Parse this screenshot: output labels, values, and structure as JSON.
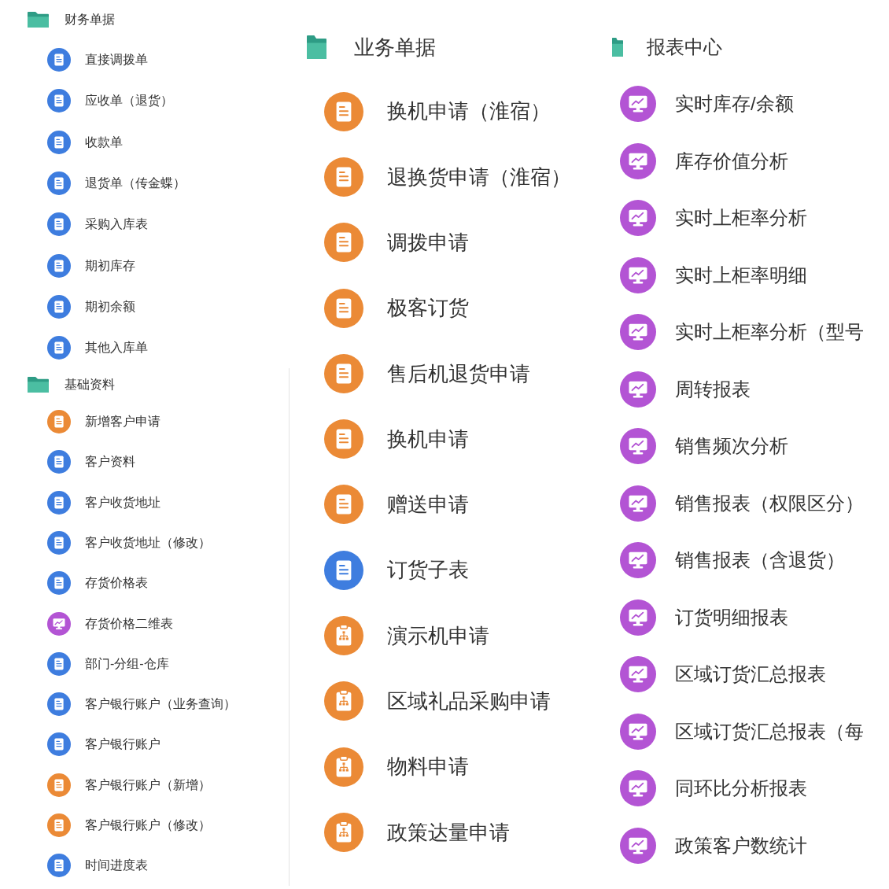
{
  "columns": [
    {
      "sections": [
        {
          "title": "财务单据",
          "items": [
            {
              "label": "直接调拨单",
              "kind": "document",
              "color": "#3e7ddf"
            },
            {
              "label": "应收单（退货）",
              "kind": "document",
              "color": "#3e7ddf"
            },
            {
              "label": "收款单",
              "kind": "document",
              "color": "#3e7ddf"
            },
            {
              "label": "退货单（传金蝶）",
              "kind": "document",
              "color": "#3e7ddf"
            },
            {
              "label": "采购入库表",
              "kind": "document",
              "color": "#3e7ddf"
            },
            {
              "label": "期初库存",
              "kind": "document",
              "color": "#3e7ddf"
            },
            {
              "label": "期初余额",
              "kind": "document",
              "color": "#3e7ddf"
            },
            {
              "label": "其他入库单",
              "kind": "document",
              "color": "#3e7ddf"
            }
          ]
        },
        {
          "title": "基础资料",
          "items": [
            {
              "label": "新增客户申请",
              "kind": "document",
              "color": "#eb8a36"
            },
            {
              "label": "客户资料",
              "kind": "document",
              "color": "#3e7ddf"
            },
            {
              "label": "客户收货地址",
              "kind": "document",
              "color": "#3e7ddf"
            },
            {
              "label": "客户收货地址（修改）",
              "kind": "document",
              "color": "#3e7ddf"
            },
            {
              "label": "存货价格表",
              "kind": "document",
              "color": "#3e7ddf"
            },
            {
              "label": "存货价格二维表",
              "kind": "report",
              "color": "#b354d4"
            },
            {
              "label": "部门-分组-仓库",
              "kind": "document",
              "color": "#3e7ddf"
            },
            {
              "label": "客户银行账户（业务查询）",
              "kind": "document",
              "color": "#3e7ddf"
            },
            {
              "label": "客户银行账户",
              "kind": "document",
              "color": "#3e7ddf"
            },
            {
              "label": "客户银行账户（新增）",
              "kind": "document",
              "color": "#eb8a36"
            },
            {
              "label": "客户银行账户（修改）",
              "kind": "document",
              "color": "#eb8a36"
            },
            {
              "label": "时间进度表",
              "kind": "document",
              "color": "#3e7ddf"
            }
          ]
        }
      ]
    },
    {
      "sections": [
        {
          "title": "业务单据",
          "items": [
            {
              "label": "换机申请（淮宿）",
              "kind": "document",
              "color": "#eb8a36"
            },
            {
              "label": "退换货申请（淮宿）",
              "kind": "document",
              "color": "#eb8a36"
            },
            {
              "label": "调拨申请",
              "kind": "document",
              "color": "#eb8a36"
            },
            {
              "label": "极客订货",
              "kind": "document",
              "color": "#eb8a36"
            },
            {
              "label": "售后机退货申请",
              "kind": "document",
              "color": "#eb8a36"
            },
            {
              "label": "换机申请",
              "kind": "document",
              "color": "#eb8a36"
            },
            {
              "label": "赠送申请",
              "kind": "document",
              "color": "#eb8a36"
            },
            {
              "label": "订货子表",
              "kind": "document",
              "color": "#3e7ddf"
            },
            {
              "label": "演示机申请",
              "kind": "clipboard",
              "color": "#eb8a36"
            },
            {
              "label": "区域礼品采购申请",
              "kind": "clipboard",
              "color": "#eb8a36"
            },
            {
              "label": "物料申请",
              "kind": "clipboard",
              "color": "#eb8a36"
            },
            {
              "label": "政策达量申请",
              "kind": "clipboard",
              "color": "#eb8a36"
            }
          ]
        }
      ]
    },
    {
      "sections": [
        {
          "title": "报表中心",
          "items": [
            {
              "label": "实时库存/余额",
              "kind": "report",
              "color": "#b354d4"
            },
            {
              "label": "库存价值分析",
              "kind": "report",
              "color": "#b354d4"
            },
            {
              "label": "实时上柜率分析",
              "kind": "report",
              "color": "#b354d4"
            },
            {
              "label": "实时上柜率明细",
              "kind": "report",
              "color": "#b354d4"
            },
            {
              "label": "实时上柜率分析（型号",
              "kind": "report",
              "color": "#b354d4"
            },
            {
              "label": "周转报表",
              "kind": "report",
              "color": "#b354d4"
            },
            {
              "label": "销售频次分析",
              "kind": "report",
              "color": "#b354d4"
            },
            {
              "label": "销售报表（权限区分）",
              "kind": "report",
              "color": "#b354d4"
            },
            {
              "label": "销售报表（含退货）",
              "kind": "report",
              "color": "#b354d4"
            },
            {
              "label": "订货明细报表",
              "kind": "report",
              "color": "#b354d4"
            },
            {
              "label": "区域订货汇总报表",
              "kind": "report",
              "color": "#b354d4"
            },
            {
              "label": "区域订货汇总报表（每",
              "kind": "report",
              "color": "#b354d4"
            },
            {
              "label": "同环比分析报表",
              "kind": "report",
              "color": "#b354d4"
            },
            {
              "label": "政策客户数统计",
              "kind": "report",
              "color": "#b354d4"
            }
          ]
        }
      ]
    }
  ]
}
